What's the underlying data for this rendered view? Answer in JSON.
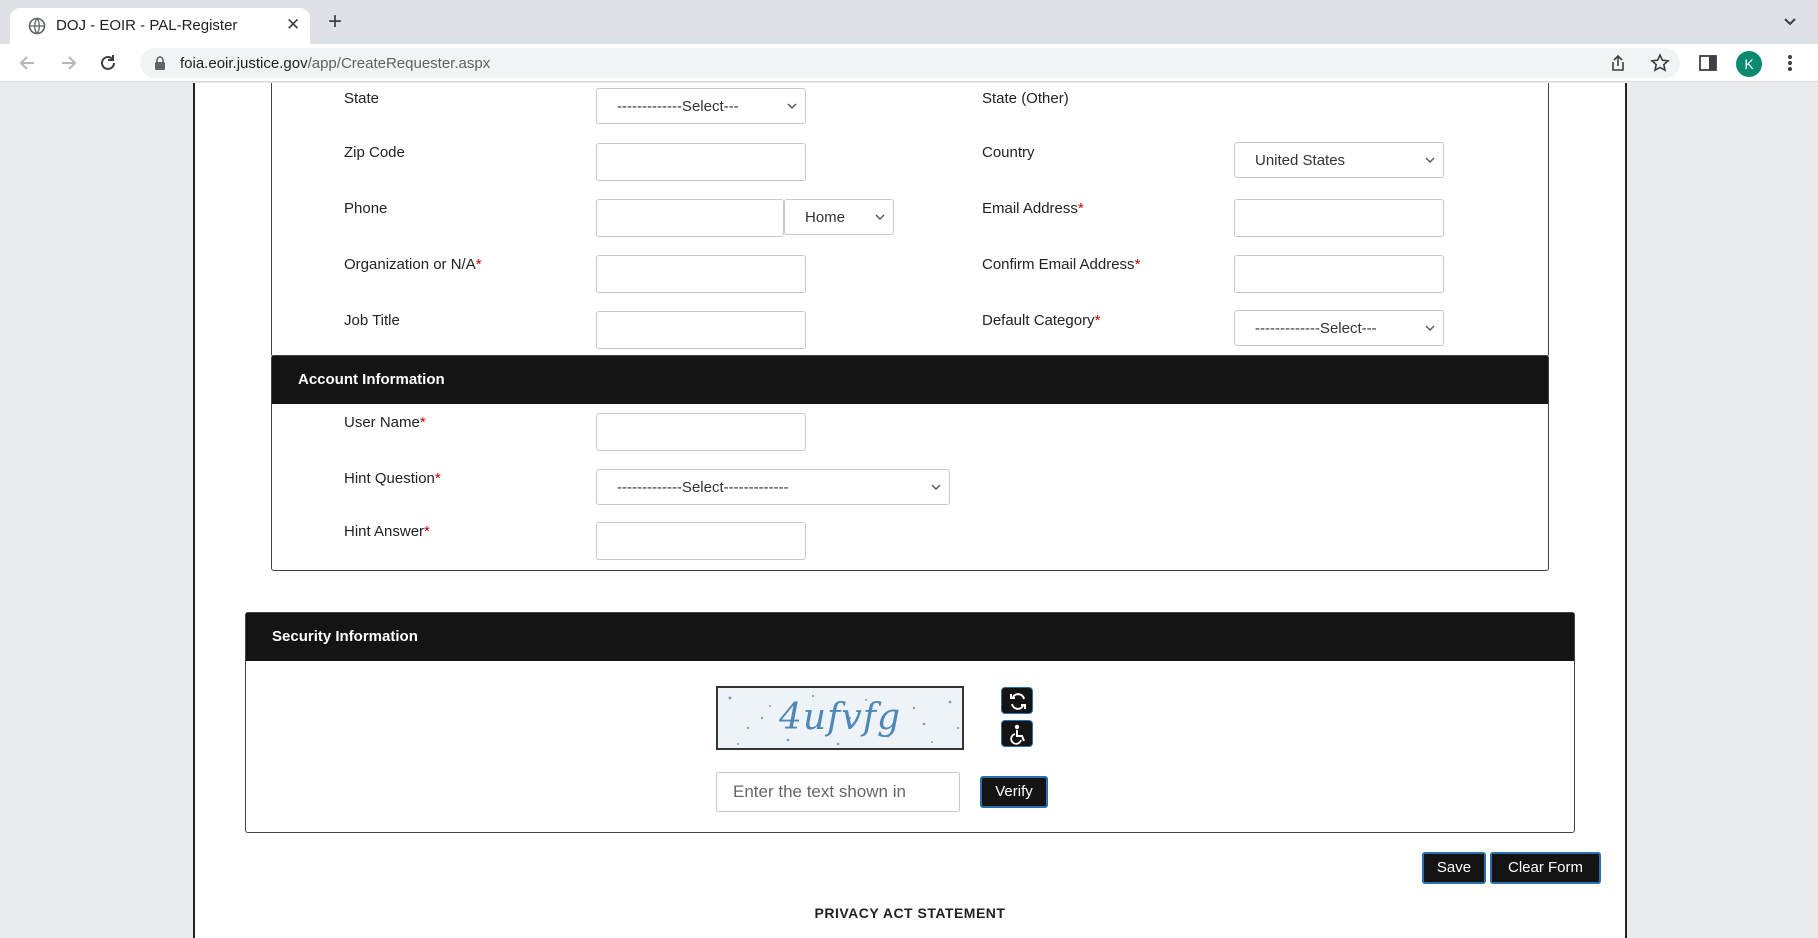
{
  "browser": {
    "tab_title": "DOJ - EOIR - PAL-Register",
    "tab_close": "✕",
    "new_tab": "+",
    "url_domain": "foia.eoir.justice.gov",
    "url_path": "/app/CreateRequester.aspx",
    "profile_initial": "K"
  },
  "contact_section": {
    "state_label": "State",
    "state_value": "-------------Select---",
    "state_other_label": "State (Other)",
    "zip_label": "Zip Code",
    "country_label": "Country",
    "country_value": "United States",
    "phone_label": "Phone",
    "phone_type_value": "Home",
    "email_label": "Email Address",
    "org_label": "Organization or N/A",
    "confirm_email_label": "Confirm Email Address",
    "job_title_label": "Job Title",
    "default_category_label": "Default Category",
    "default_category_value": "-------------Select---",
    "required_mark": "*"
  },
  "account_section": {
    "title": "Account Information",
    "username_label": "User Name",
    "hint_question_label": "Hint Question",
    "hint_question_value": "-------------Select-------------",
    "hint_answer_label": "Hint Answer",
    "required_mark": "*"
  },
  "security_section": {
    "title": "Security Information",
    "captcha_text": "4ufvfg",
    "captcha_input_placeholder": "Enter the text shown in",
    "verify_label": "Verify"
  },
  "actions": {
    "save_label": "Save",
    "clear_label": "Clear Form"
  },
  "footer": {
    "privacy_heading": "PRIVACY ACT STATEMENT"
  }
}
